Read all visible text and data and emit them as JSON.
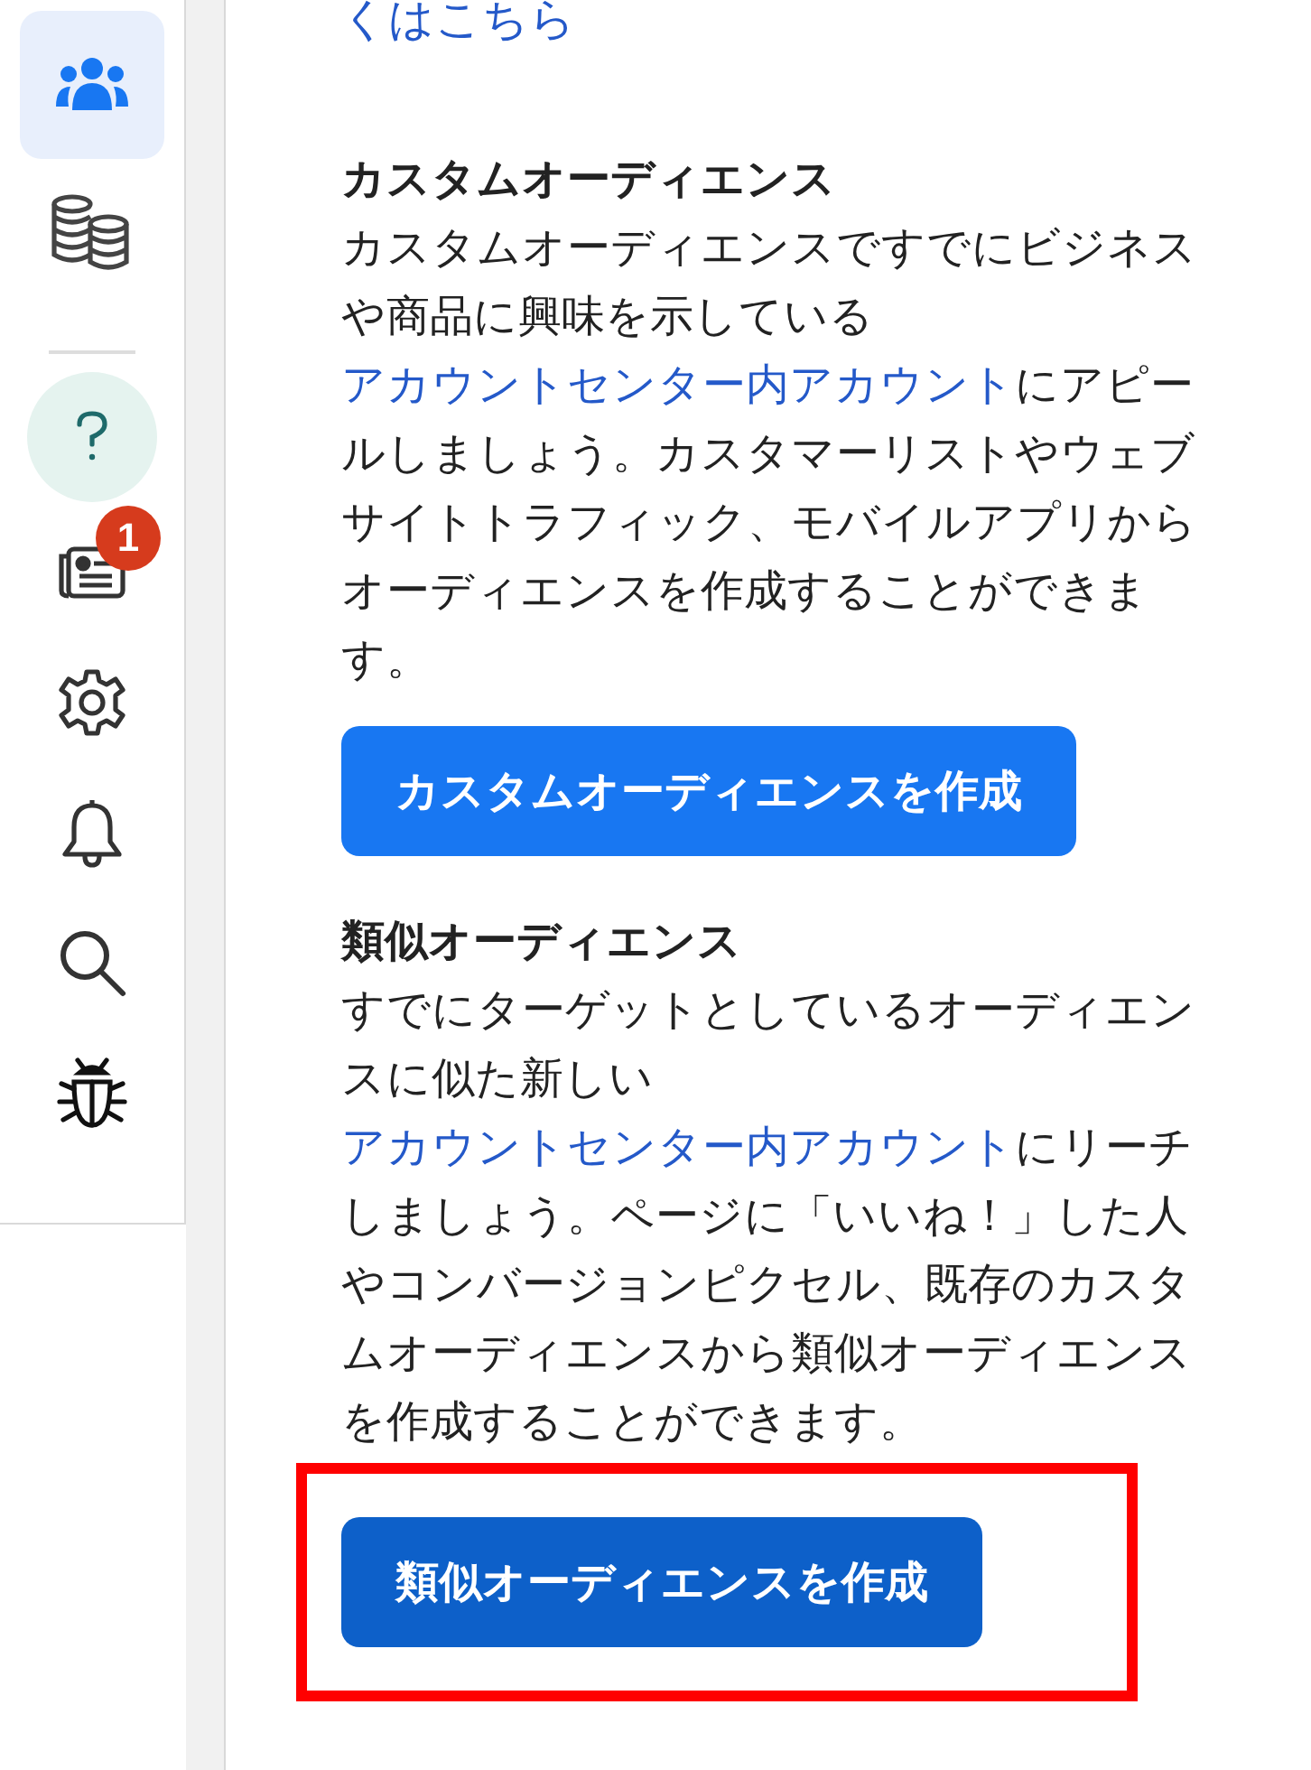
{
  "sidebar": {
    "top_items": [
      {
        "selected": true
      },
      {
        "selected": false
      }
    ],
    "bottom_items": [
      {
        "kind": "help",
        "selected": false
      },
      {
        "kind": "nav",
        "selected": false,
        "badge": "1"
      },
      {
        "kind": "nav",
        "selected": false
      },
      {
        "kind": "nav",
        "selected": false
      },
      {
        "kind": "nav",
        "selected": false
      },
      {
        "kind": "nav",
        "selected": false
      }
    ]
  },
  "top_link": "くはこちら",
  "sections": [
    {
      "heading": "カスタムオーディエンス",
      "body": [
        {
          "kind": "text",
          "text": "カスタムオーディエンスですでにビジネスや商品に興味を示している"
        },
        {
          "kind": "link",
          "text": "アカウントセンター内アカウント"
        },
        {
          "kind": "text",
          "text": "にアピールしましょう。カスタマーリストやウェブサイトトラフィック、モバイルアプリからオーディエンスを作成することができます。"
        }
      ],
      "button": {
        "label": "カスタムオーディエンスを作成",
        "highlighted": false
      }
    },
    {
      "heading": "類似オーディエンス",
      "body": [
        {
          "kind": "text",
          "text": "すでにターゲットとしているオーディエンスに似た新しい"
        },
        {
          "kind": "link",
          "text": "アカウントセンター内アカウント"
        },
        {
          "kind": "text",
          "text": "にリーチしましょう。ページに「いいね！」した人やコンバージョンピクセル、既存のカスタムオーディエンスから類似オーディエンスを作成することができます。"
        }
      ],
      "button": {
        "label": "類似オーディエンスを作成",
        "highlighted": true
      }
    }
  ]
}
